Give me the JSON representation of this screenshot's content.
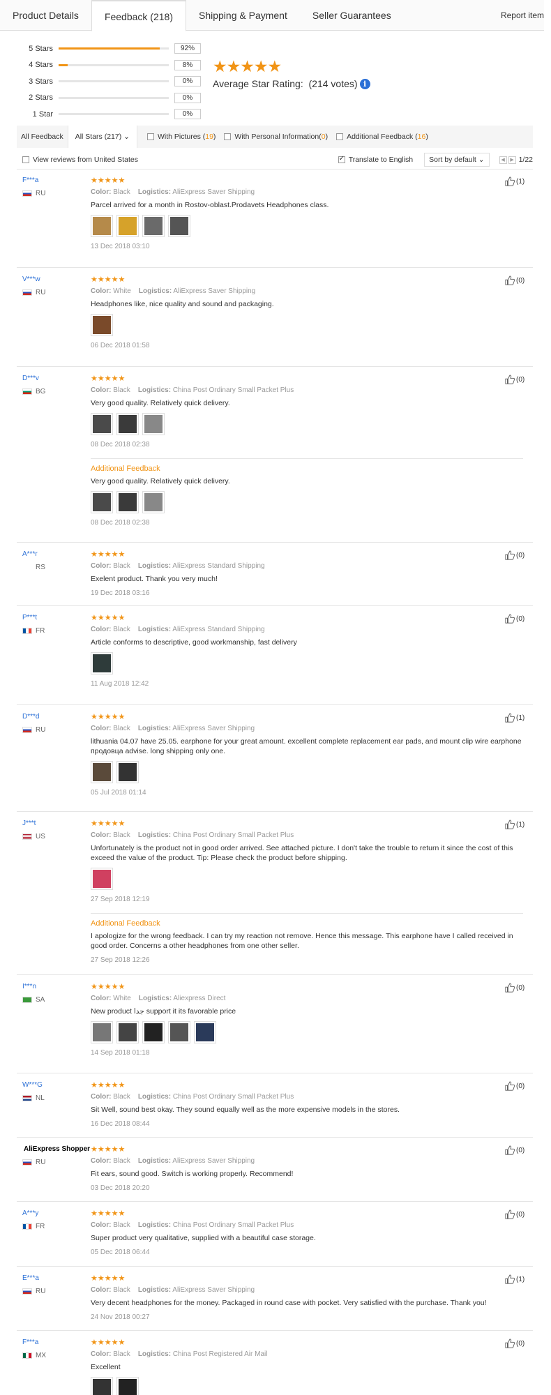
{
  "tabs": [
    {
      "label": "Product Details"
    },
    {
      "label": "Feedback (218)"
    },
    {
      "label": "Shipping & Payment"
    },
    {
      "label": "Seller Guarantees"
    }
  ],
  "report_label": "Report item",
  "ratings": [
    {
      "label": "5 Stars",
      "pct": "92%",
      "fill": 0.92
    },
    {
      "label": "4 Stars",
      "pct": "8%",
      "fill": 0.08
    },
    {
      "label": "3 Stars",
      "pct": "0%",
      "fill": 0
    },
    {
      "label": "2 Stars",
      "pct": "0%",
      "fill": 0
    },
    {
      "label": "1 Star",
      "pct": "0%",
      "fill": 0
    }
  ],
  "average": {
    "stars": "★★★★★",
    "label": "Average Star Rating:",
    "votes": "(214 votes)",
    "info_icon": "i"
  },
  "filter": {
    "all": "All Feedback",
    "stars_select": "All Stars (217)",
    "with_pictures": "With Pictures (",
    "with_pictures_count": "19",
    "with_personal": "With Personal Information(",
    "with_personal_count": "0",
    "additional": "Additional Feedback (",
    "additional_count": "16",
    "close": ")"
  },
  "row2": {
    "view_us": "View reviews from United States",
    "translate": "Translate to English",
    "sort": "Sort by default",
    "page": "1/22"
  },
  "labels": {
    "color": "Color:",
    "logistics": "Logistics:",
    "additional_feedback": "Additional Feedback",
    "stars": "★★★★★"
  },
  "reviews": [
    {
      "user": "F***a",
      "country": "RU",
      "color": "Black",
      "logistics": "AliExpress Saver Shipping",
      "text": "Parcel arrived for a month in Rostov-oblast.Prodavets Headphones class.",
      "date": "13 Dec 2018 03:10",
      "likes": "(1)"
    },
    {
      "user": "V***w",
      "country": "RU",
      "color": "White",
      "logistics": "AliExpress Saver Shipping",
      "text": "Headphones like, nice quality and sound and packaging.",
      "date": "06 Dec 2018 01:58",
      "likes": "(0)"
    },
    {
      "user": "D***v",
      "country": "BG",
      "color": "Black",
      "logistics": "China Post Ordinary Small Packet Plus",
      "text": "Very good quality. Relatively quick delivery.",
      "date": "08 Dec 2018 02:38",
      "likes": "(0)",
      "add_text": "Very good quality. Relatively quick delivery.",
      "add_date": "08 Dec 2018 02:38"
    },
    {
      "user": "A***r",
      "country": "RS",
      "color": "Black",
      "logistics": "AliExpress Standard Shipping",
      "text": "Exelent product. Thank you very much!",
      "date": "19 Dec 2018 03:16",
      "likes": "(0)"
    },
    {
      "user": "P***t",
      "country": "FR",
      "color": "Black",
      "logistics": "AliExpress Standard Shipping",
      "text": "Article conforms to descriptive, good workmanship, fast delivery",
      "date": "11 Aug 2018 12:42",
      "likes": "(0)"
    },
    {
      "user": "D***d",
      "country": "RU",
      "color": "Black",
      "logistics": "AliExpress Saver Shipping",
      "text": "lithuania 04.07 have 25.05. earphone for your great amount. excellent complete replacement ear pads, and mount clip wire earphone продовца advise. long shipping only one.",
      "date": "05 Jul 2018 01:14",
      "likes": "(1)"
    },
    {
      "user": "J***t",
      "country": "US",
      "color": "Black",
      "logistics": "China Post Ordinary Small Packet Plus",
      "text": "Unfortunately is the product not in good order arrived. See attached picture. I don't take the trouble to return it since the cost of this exceed the value of the product. Tip: Please check the product before shipping.",
      "date": "27 Sep 2018 12:19",
      "likes": "(1)",
      "add_text": "I apologize for the wrong feedback. I can try my reaction not remove. Hence this message. This earphone have I called received in good order. Concerns a other headphones from one other seller.",
      "add_date": "27 Sep 2018 12:26"
    },
    {
      "user": "I***n",
      "country": "SA",
      "color": "White",
      "logistics": "Aliexpress Direct",
      "text": "New product جدا support it its favorable price",
      "date": "14 Sep 2018 01:18",
      "likes": "(0)"
    },
    {
      "user": "W***G",
      "country": "NL",
      "color": "Black",
      "logistics": "China Post Ordinary Small Packet Plus",
      "text": "Sit Well, sound best okay. They sound equally well as the more expensive models in the stores.",
      "date": "16 Dec 2018 08:44",
      "likes": "(0)"
    },
    {
      "user": "AliExpress Shopper",
      "country": "RU",
      "color": "Black",
      "logistics": "AliExpress Saver Shipping",
      "text": "Fit ears, sound good. Switch is working properly. Recommend!",
      "date": "03 Dec 2018 20:20",
      "likes": "(0)"
    },
    {
      "user": "A***y",
      "country": "FR",
      "color": "Black",
      "logistics": "China Post Ordinary Small Packet Plus",
      "text": "Super product very qualitative, supplied with a beautiful case storage.",
      "date": "05 Dec 2018 06:44",
      "likes": "(0)"
    },
    {
      "user": "E***a",
      "country": "RU",
      "color": "Black",
      "logistics": "AliExpress Saver Shipping",
      "text": "Very decent headphones for the money. Packaged in round case with pocket. Very satisfied with the purchase. Thank you!",
      "date": "24 Nov 2018 00:27",
      "likes": "(1)"
    },
    {
      "user": "F***a",
      "country": "MX",
      "color": "Black",
      "logistics": "China Post Registered Air Mail",
      "text": "Excellent",
      "likes": "(0)"
    }
  ],
  "colors": {
    "accent": "#f19416",
    "link": "#2a6fd6"
  }
}
